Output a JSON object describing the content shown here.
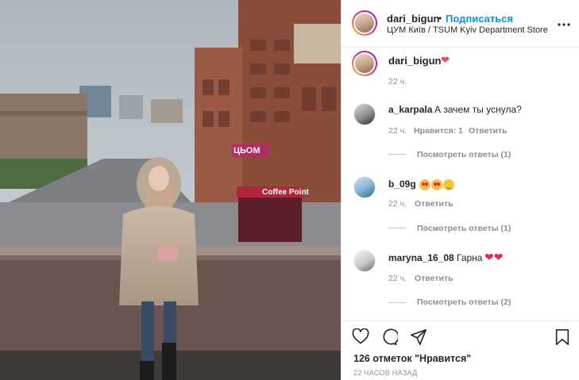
{
  "post": {
    "username": "dari_bigun",
    "follow_label": "Подписаться",
    "separator": "•",
    "location": "ЦУМ Київ / TSUM Kyiv Department Store",
    "more_icon": "more-horizontal-icon"
  },
  "caption": {
    "username": "dari_bigun",
    "time": "22 ч."
  },
  "comments": [
    {
      "username": "a_karpala",
      "text": "А зачем ты уснула?",
      "time": "22 ч.",
      "likes": "Нравится: 1",
      "reply": "Ответить",
      "view_replies": "Посмотреть ответы (1)"
    },
    {
      "username": "b_09g",
      "text": "",
      "time": "22 ч.",
      "reply": "Ответить",
      "view_replies": "Посмотреть ответы (1)"
    },
    {
      "username": "maryna_16_08",
      "text": "Гарна",
      "time": "22 ч.",
      "reply": "Ответить",
      "view_replies": "Посмотреть ответы (2)"
    }
  ],
  "footer": {
    "likes": "126 отметок \"Нравится\"",
    "timestamp": "22 ЧАСОВ НАЗАД"
  },
  "photo_signs": {
    "store_sign": "ЦЬОМ",
    "kiosk_sign": "Coffee Point"
  },
  "colors": {
    "accent": "#0095f6",
    "text": "#262626",
    "muted": "#8e8e8e",
    "heart": "#ed4956"
  }
}
